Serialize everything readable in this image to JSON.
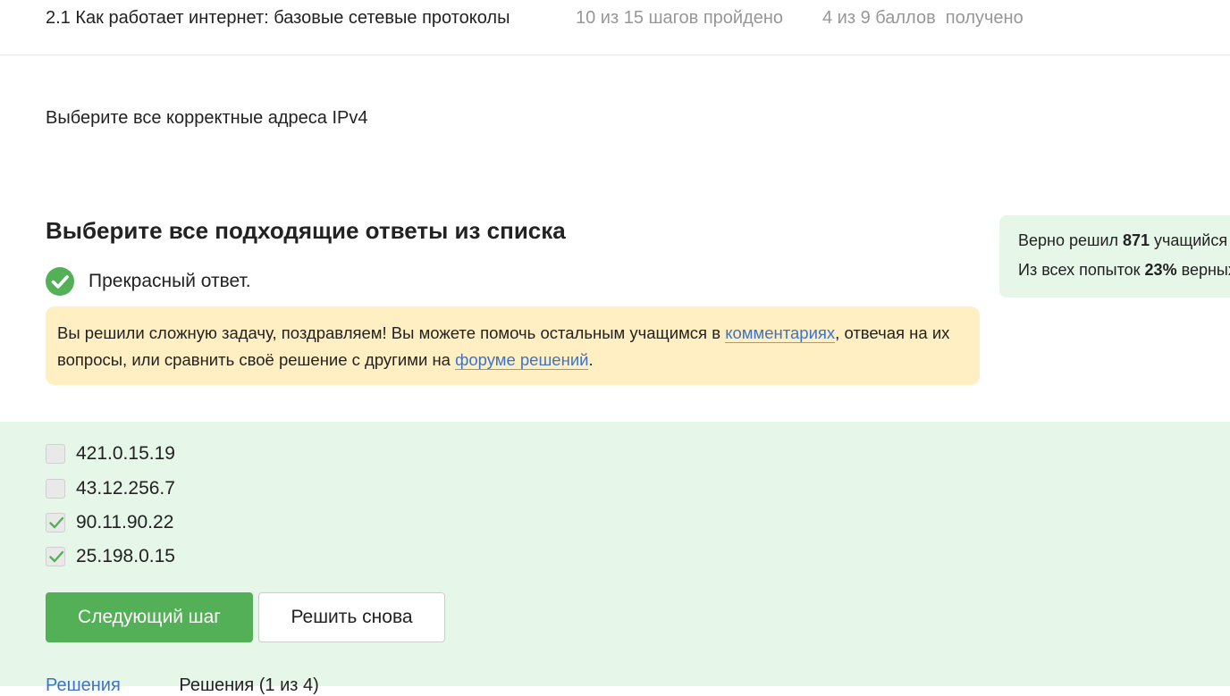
{
  "header": {
    "title": "2.1 Как работает интернет: базовые сетевые протоколы",
    "steps": "10 из 15 шагов пройдено",
    "points": "4 из 9 баллов  получено"
  },
  "question": "Выберите все корректные адреса IPv4",
  "instruction": "Выберите все подходящие ответы из списка",
  "result": {
    "text": "Прекрасный ответ.",
    "icon": "check-circle-icon"
  },
  "notice": {
    "part1": "Вы решили сложную задачу, поздравляем! Вы можете помочь остальным учащимся в ",
    "link1": "комментариях",
    "part2": ", отвечая на их вопросы, или сравнить своё решение с другими на ",
    "link2": "форуме решений",
    "part3": "."
  },
  "stats": {
    "line1_prefix": "Верно решил ",
    "line1_value": "871",
    "line1_suffix": " учащийся",
    "line2_prefix": "Из всех попыток ",
    "line2_value": "23%",
    "line2_suffix": " верных"
  },
  "options": [
    {
      "label": "421.0.15.19",
      "checked": false
    },
    {
      "label": "43.12.256.7",
      "checked": false
    },
    {
      "label": "90.11.90.22",
      "checked": true
    },
    {
      "label": "25.198.0.15",
      "checked": true
    }
  ],
  "buttons": {
    "next": "Следующий шаг",
    "retry": "Решить снова"
  },
  "bottom": {
    "link": "Решения",
    "text": "Решения (1 из 4)"
  },
  "colors": {
    "green": "#54b056",
    "notice_bg": "#ffefc2",
    "panel_bg": "#e6f6e8",
    "link": "#3d73c7"
  }
}
